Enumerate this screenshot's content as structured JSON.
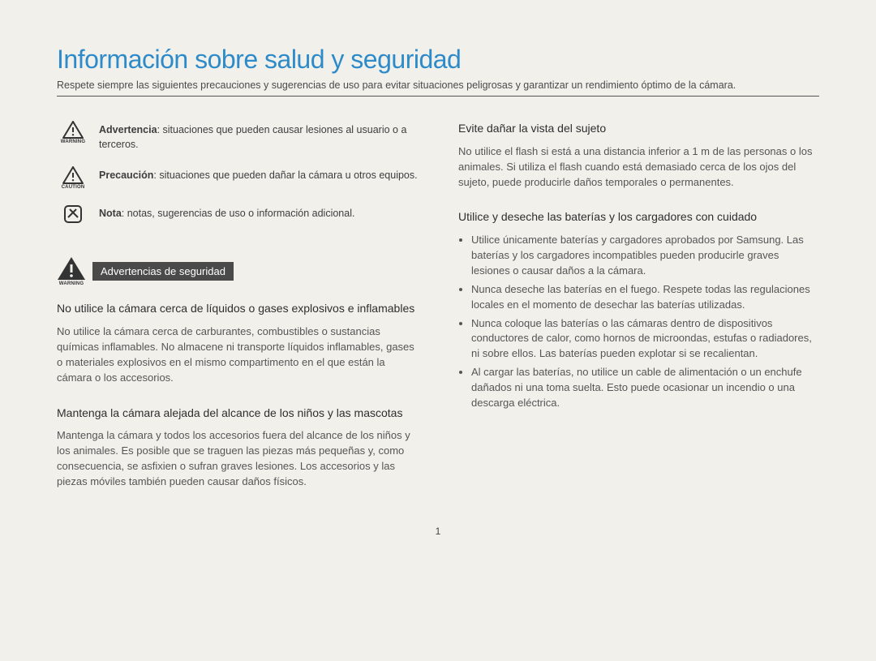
{
  "title": "Información sobre salud y seguridad",
  "intro": "Respete siempre las siguientes precauciones y sugerencias de uso para evitar situaciones peligrosas y garantizar un rendimiento óptimo de la cámara.",
  "definitions": {
    "warning": {
      "label": "Advertencia",
      "text": ": situaciones que pueden causar lesiones al usuario o a terceros.",
      "caption": "WARNING"
    },
    "caution": {
      "label": "Precaución",
      "text": ": situaciones que pueden dañar la cámara u otros equipos.",
      "caption": "CAUTION"
    },
    "note": {
      "label": "Nota",
      "text": ": notas, sugerencias de uso o información adicional."
    }
  },
  "banner": {
    "label": "Advertencias de seguridad",
    "caption": "WARNING"
  },
  "leftSections": [
    {
      "heading": "No utilice la cámara cerca de líquidos o gases explosivos e inflamables",
      "body": "No utilice la cámara cerca de carburantes, combustibles o sustancias químicas inflamables. No almacene ni transporte líquidos inflamables, gases o materiales explosivos en el mismo compartimento en el que están la cámara o los accesorios."
    },
    {
      "heading": "Mantenga la cámara alejada del alcance de los niños y las mascotas",
      "body": "Mantenga la cámara y todos los accesorios fuera del alcance de los niños y los animales. Es posible que se traguen las piezas más pequeñas y, como consecuencia, se asfixien o sufran graves lesiones. Los accesorios y las piezas móviles también pueden causar daños físicos."
    }
  ],
  "rightSections": [
    {
      "heading": "Evite dañar la vista del sujeto",
      "body": "No utilice el flash si está a una distancia inferior a 1 m de las personas o los animales. Si utiliza el flash cuando está demasiado cerca de los ojos del sujeto, puede producirle daños temporales o permanentes."
    },
    {
      "heading": "Utilice y deseche las baterías y los cargadores con cuidado",
      "bullets": [
        "Utilice únicamente baterías y cargadores aprobados por Samsung. Las baterías y los cargadores incompatibles pueden producirle graves lesiones o causar daños a la cámara.",
        "Nunca deseche las baterías en el fuego. Respete todas las regulaciones locales en el momento de desechar las baterías utilizadas.",
        "Nunca coloque las baterías o las cámaras dentro de dispositivos conductores de calor, como hornos de microondas, estufas o radiadores, ni sobre ellos. Las baterías pueden explotar si se recalientan.",
        "Al cargar las baterías, no utilice un cable de alimentación o un enchufe dañados ni una toma suelta. Esto puede ocasionar un incendio o una descarga eléctrica."
      ]
    }
  ],
  "pageNumber": "1"
}
